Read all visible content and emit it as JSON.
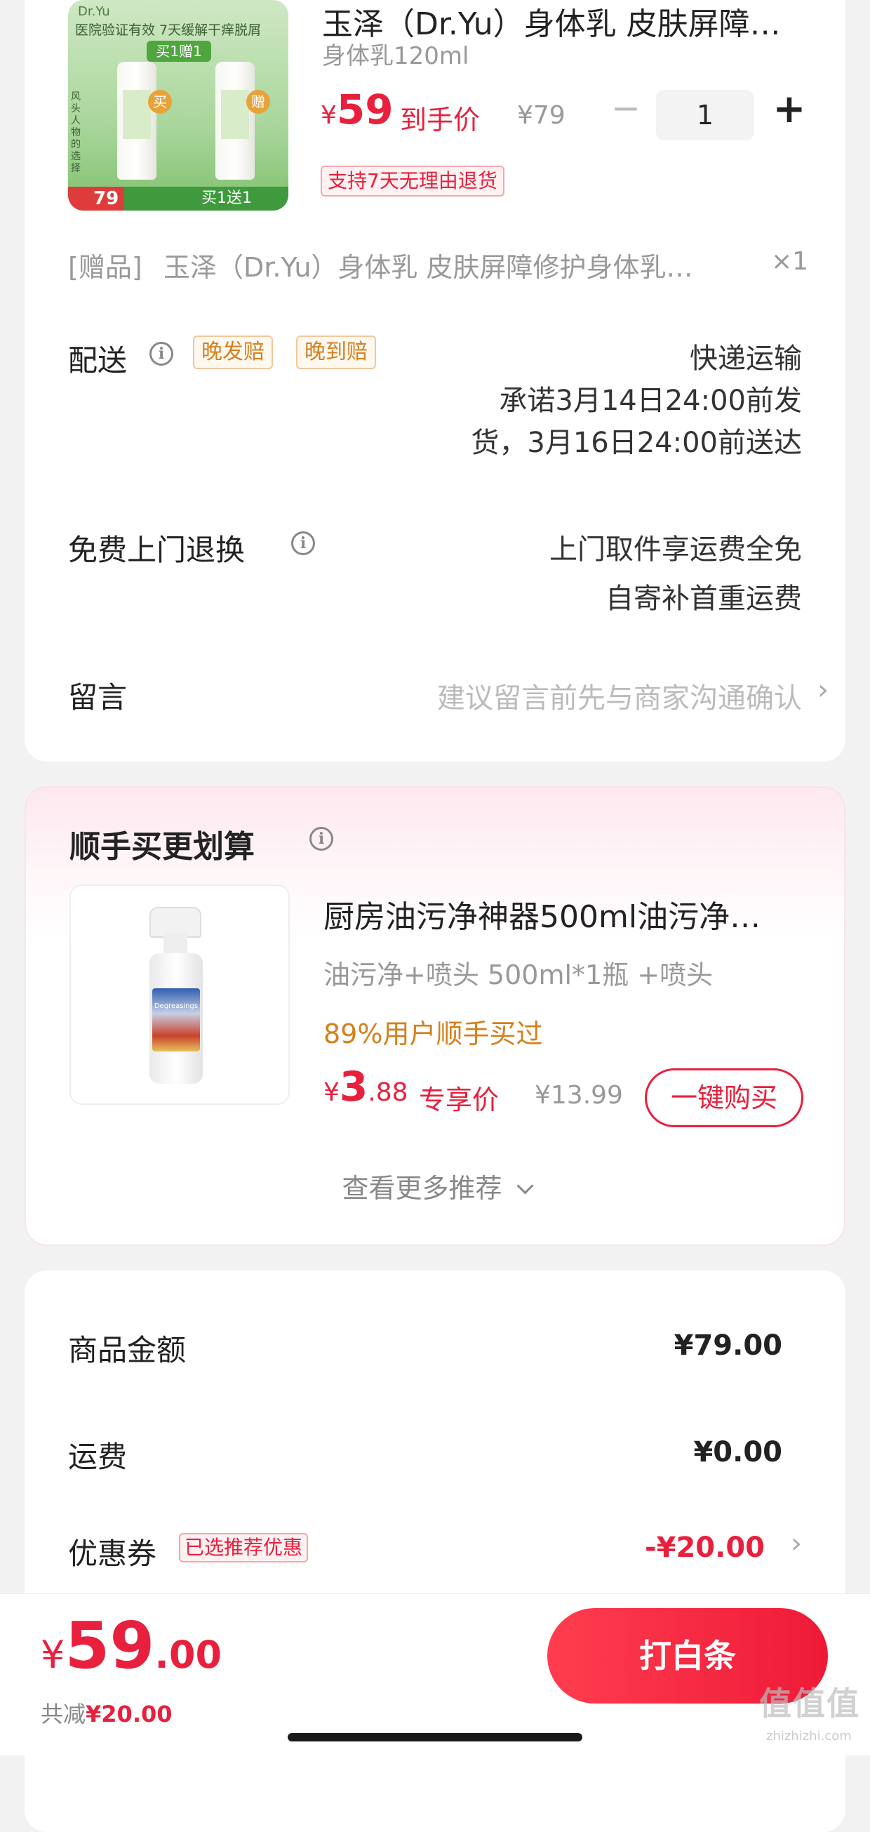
{
  "product": {
    "image": {
      "line1": "医院验证有效 7天缓解干痒脱屑",
      "badge": "买1赠1",
      "left_tag": "买",
      "right_tag": "赠",
      "price": "79",
      "promo": "买1送1",
      "side_text": "风头人物的选择",
      "brand": "Dr.Yu"
    },
    "title": "玉泽（Dr.Yu）身体乳 皮肤屏障…",
    "spec": "身体乳120ml",
    "price_symbol": "¥",
    "price": "59",
    "price_label": "到手价",
    "original_price": "¥79",
    "quantity": "1",
    "minus": "−",
    "plus": "+",
    "return_tag": "支持7天无理由退货"
  },
  "gift": {
    "label": "[赠品]",
    "name": "玉泽（Dr.Yu）身体乳 皮肤屏障修护身体乳…",
    "count": "×1"
  },
  "delivery": {
    "label": "配送",
    "tags": [
      "晚发赔",
      "晚到赔"
    ],
    "method": "快递运输",
    "promise_line1": "承诺3月14日24:00前发",
    "promise_line2": "货，3月16日24:00前送达"
  },
  "returns": {
    "label": "免费上门退换",
    "line1": "上门取件享运费全免",
    "line2": "自寄补首重运费"
  },
  "message": {
    "label": "留言",
    "placeholder": "建议留言前先与商家沟通确认"
  },
  "upsell": {
    "title": "顺手买更划算",
    "product_title": "厨房油污净神器500ml油污净…",
    "spec": "油污净+喷头 500ml*1瓶 +喷头",
    "social_proof": "89%用户顺手买过",
    "price_symbol": "¥",
    "price_int": "3",
    "price_dec": ".88",
    "price_label": "专享价",
    "original_price": "¥13.99",
    "buy_button": "一键购买",
    "more": "查看更多推荐",
    "bottle_label": "Degreasings"
  },
  "summary": {
    "goods_label": "商品金额",
    "goods_value": "¥79.00",
    "shipping_label": "运费",
    "shipping_value": "¥0.00",
    "coupon_label": "优惠券",
    "coupon_tag": "已选推荐优惠",
    "coupon_value": "-¥20.00"
  },
  "footer": {
    "price_symbol": "¥",
    "price_int": "59",
    "price_dec": ".00",
    "saved_label": "共减",
    "saved_value": "¥20.00",
    "pay_button": "打白条"
  },
  "watermark": {
    "logo": "值值值",
    "url": "zhizhizhi.com"
  },
  "colors": {
    "accent": "#e8203d",
    "tag_orange": "#d5801d",
    "price_gradient_start": "#ff3d4f",
    "price_gradient_end": "#ee1a38"
  }
}
